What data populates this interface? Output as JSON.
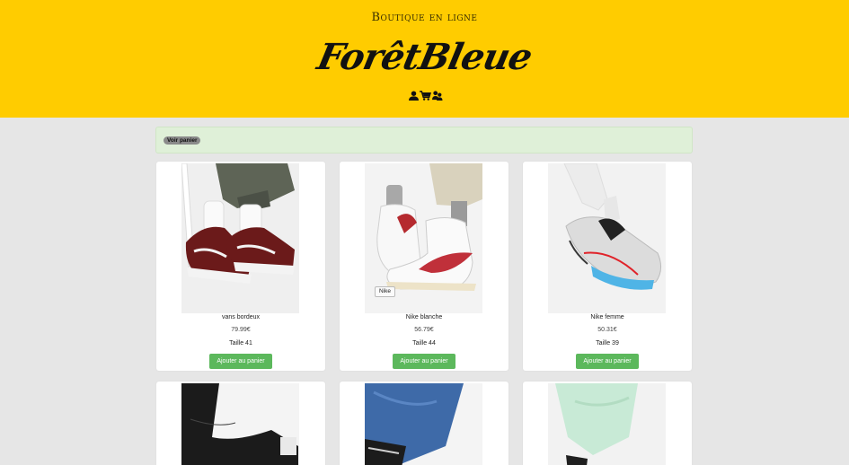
{
  "header": {
    "subtitle": "Boutique en ligne",
    "brand": "ForêtBleue",
    "icons": [
      "user-icon",
      "cart-icon",
      "users-icon"
    ]
  },
  "cart_bar": {
    "button_label": "Voir panier"
  },
  "products": [
    {
      "name": "vans bordeux",
      "price": "79.99€",
      "size": "Taille 41",
      "button": "Ajouter au panier"
    },
    {
      "name": "Nike blanche",
      "price": "56.79€",
      "size": "Taille 44",
      "button": "Ajouter au panier",
      "tag": "Nike"
    },
    {
      "name": "Nike femme",
      "price": "50.31€",
      "size": "Taille 39",
      "button": "Ajouter au panier"
    }
  ],
  "colors": {
    "header_bg": "#ffcc00",
    "button_bg": "#5cb85c",
    "cart_bar_bg": "#dff0d8"
  }
}
